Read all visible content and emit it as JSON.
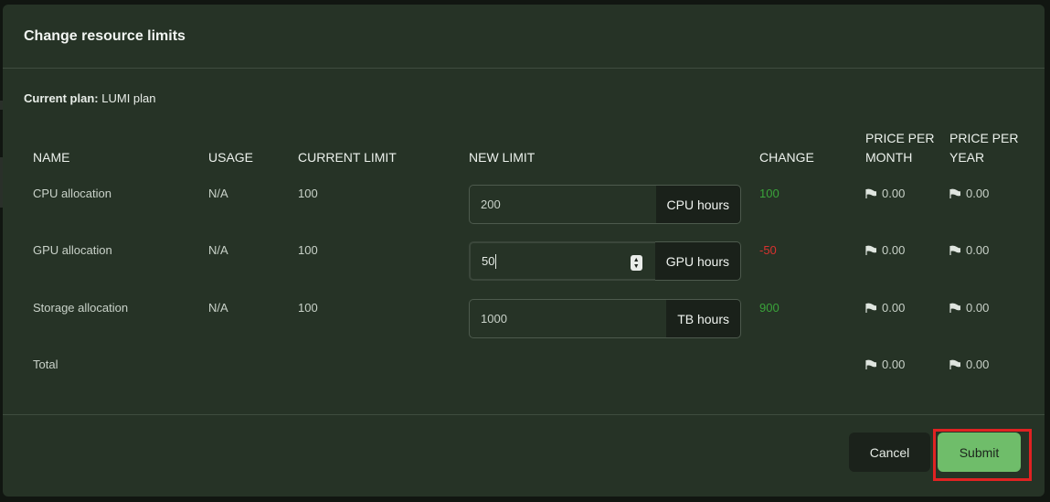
{
  "dialog": {
    "title": "Change resource limits",
    "plan_label": "Current plan:",
    "plan_value": "LUMI plan"
  },
  "table": {
    "headers": {
      "name": "NAME",
      "usage": "USAGE",
      "current_limit": "CURRENT LIMIT",
      "new_limit": "NEW LIMIT",
      "change": "CHANGE",
      "price_month_1": "PRICE PER",
      "price_month_2": "MONTH",
      "price_year_1": "PRICE PER",
      "price_year_2": "YEAR"
    },
    "rows": [
      {
        "name": "CPU allocation",
        "usage": "N/A",
        "current_limit": "100",
        "new_limit": "200",
        "unit": "CPU hours",
        "change": "100",
        "change_status": "positive",
        "price_month": "0.00",
        "price_year": "0.00"
      },
      {
        "name": "GPU allocation",
        "usage": "N/A",
        "current_limit": "100",
        "new_limit": "50",
        "unit": "GPU hours",
        "change": "-50",
        "change_status": "negative",
        "price_month": "0.00",
        "price_year": "0.00"
      },
      {
        "name": "Storage allocation",
        "usage": "N/A",
        "current_limit": "100",
        "new_limit": "1000",
        "unit": "TB hours",
        "change": "900",
        "change_status": "positive",
        "price_month": "0.00",
        "price_year": "0.00"
      }
    ],
    "total": {
      "label": "Total",
      "price_month": "0.00",
      "price_year": "0.00"
    }
  },
  "footer": {
    "cancel_label": "Cancel",
    "submit_label": "Submit"
  },
  "colors": {
    "modal_bg": "#263326",
    "accent": "#6fbd6a",
    "positive": "#3aa33a",
    "negative": "#d8322f",
    "highlight": "#e02222"
  },
  "icons": {
    "currency": "euro-flag-icon",
    "stepper": "spin-stepper-icon"
  }
}
